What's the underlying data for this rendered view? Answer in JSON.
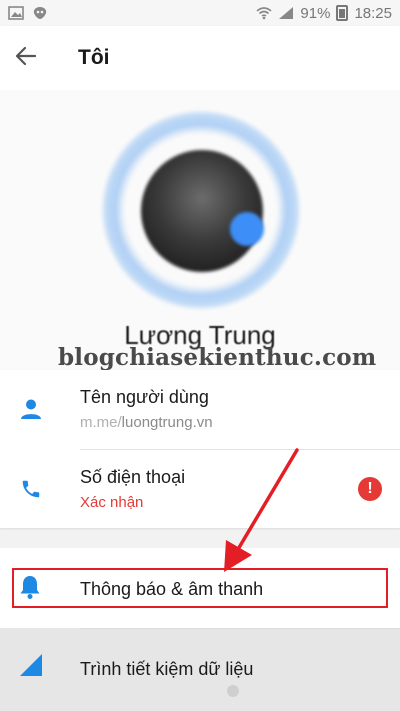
{
  "status_bar": {
    "battery_text": "91%",
    "time": "18:25"
  },
  "header": {
    "title": "Tôi"
  },
  "profile": {
    "name": "Lương Trung",
    "watermark": "blogchiasekienthuc.com"
  },
  "info_rows": [
    {
      "label": "Tên người dùng",
      "value": "m.me/luongtrung.vn",
      "value_prefix": "m.me/",
      "value_main": "luongtrung.vn"
    },
    {
      "label": "Số điện thoại",
      "value": "Xác nhận",
      "value_color": "#e53935"
    }
  ],
  "settings": [
    {
      "label": "Thông báo & âm thanh",
      "icon": "bell-icon"
    },
    {
      "label": "Trình tiết kiệm dữ liệu",
      "icon": "data-saver-icon"
    }
  ],
  "colors": {
    "accent": "#1e88e5",
    "warning": "#e53935",
    "annotation": "#e31e24"
  }
}
